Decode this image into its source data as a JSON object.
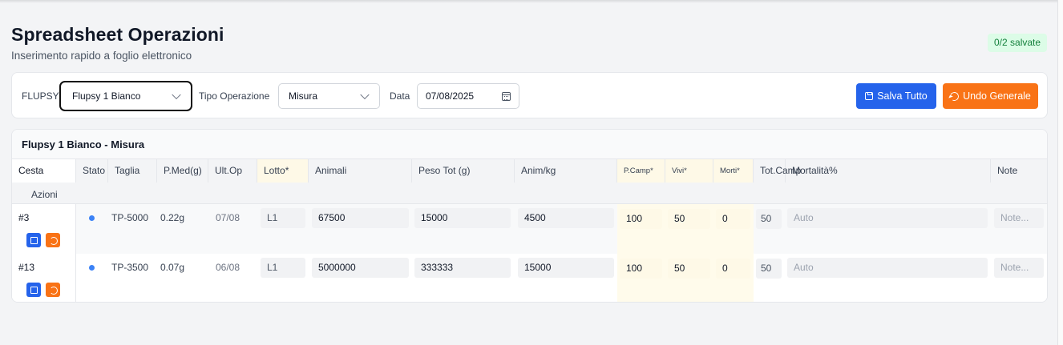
{
  "page": {
    "title": "Spreadsheet Operazioni",
    "subtitle": "Inserimento rapido a foglio elettronico",
    "saved_badge": "0/2 salvate"
  },
  "toolbar": {
    "flupsy_label": "FLUPSY",
    "flupsy_value": "Flupsy 1 Bianco",
    "tipo_label": "Tipo Operazione",
    "tipo_value": "Misura",
    "data_label": "Data",
    "data_value": "07/08/2025",
    "save_all": "Salva Tutto",
    "undo_all": "Undo Generale"
  },
  "card": {
    "title": "Flupsy 1 Bianco - Misura"
  },
  "columns": {
    "cesta": "Cesta",
    "azioni": "Azioni",
    "stato": "Stato",
    "taglia": "Taglia",
    "pmed": "P.Med(g)",
    "ultop": "Ult.Op",
    "lotto": "Lotto*",
    "animali": "Animali",
    "pesotot": "Peso Tot (g)",
    "animkg": "Anim/kg",
    "pcamp": "P.Camp*",
    "vivi": "Vivi*",
    "morti": "Morti*",
    "totcamp": "Tot.Camp",
    "mortalita": "Mortalità%",
    "note": "Note"
  },
  "rows": [
    {
      "cesta": "#3",
      "stato": "blue",
      "taglia": "TP-5000",
      "pmed": "0.22g",
      "ultop": "07/08",
      "lotto": "L1",
      "animali": "67500",
      "pesotot": "15000",
      "animkg": "4500",
      "pcamp": "100",
      "vivi": "50",
      "morti": "0",
      "totcamp": "50",
      "mortalita": "Auto",
      "note": "Note..."
    },
    {
      "cesta": "#13",
      "stato": "blue",
      "taglia": "TP-3500",
      "pmed": "0.07g",
      "ultop": "06/08",
      "lotto": "L1",
      "animali": "5000000",
      "pesotot": "333333",
      "animkg": "15000",
      "pcamp": "100",
      "vivi": "50",
      "morti": "0",
      "totcamp": "50",
      "mortalita": "Auto",
      "note": "Note..."
    }
  ],
  "colors": {
    "primary": "#2563eb",
    "accent": "#f97316",
    "success_bg": "#dcfce7",
    "success_text": "#15803d",
    "required_col_bg": "#fef9e7"
  }
}
